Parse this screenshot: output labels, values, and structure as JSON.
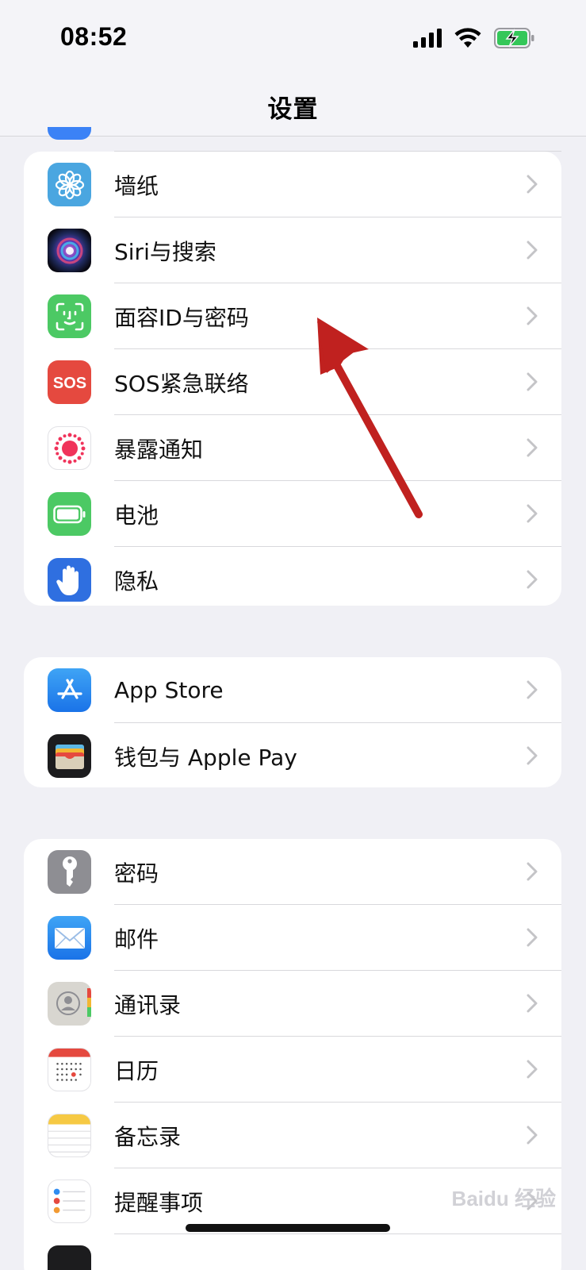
{
  "status_bar": {
    "time": "08:52"
  },
  "nav": {
    "title": "设置"
  },
  "groups": [
    {
      "items": [
        {
          "label": "墙纸",
          "icon": "wallpaper-icon",
          "color": "#4aa6e0"
        },
        {
          "label": "Siri与搜索",
          "icon": "siri-icon",
          "color": "#1a1a2e"
        },
        {
          "label": "面容ID与密码",
          "icon": "face-id-icon",
          "color": "#4cc964"
        },
        {
          "label": "SOS紧急联络",
          "icon": "sos-icon",
          "color": "#e5493f"
        },
        {
          "label": "暴露通知",
          "icon": "exposure-notification-icon",
          "color": "#ffffff"
        },
        {
          "label": "电池",
          "icon": "battery-icon",
          "color": "#4cc964"
        },
        {
          "label": "隐私",
          "icon": "privacy-hand-icon",
          "color": "#2f6fe0"
        }
      ]
    },
    {
      "items": [
        {
          "label": "App Store",
          "icon": "app-store-icon",
          "color": "#1f8cf0"
        },
        {
          "label": "钱包与 Apple Pay",
          "icon": "wallet-icon",
          "color": "#1c1c1e"
        }
      ]
    },
    {
      "items": [
        {
          "label": "密码",
          "icon": "key-icon",
          "color": "#8e8e93"
        },
        {
          "label": "邮件",
          "icon": "mail-icon",
          "color": "#2f8cf0"
        },
        {
          "label": "通讯录",
          "icon": "contacts-icon",
          "color": "#d8d6d0"
        },
        {
          "label": "日历",
          "icon": "calendar-icon",
          "color": "#ffffff"
        },
        {
          "label": "备忘录",
          "icon": "notes-icon",
          "color": "#ffffff"
        },
        {
          "label": "提醒事项",
          "icon": "reminders-icon",
          "color": "#ffffff"
        }
      ]
    }
  ],
  "watermark": "Baidu 经验"
}
